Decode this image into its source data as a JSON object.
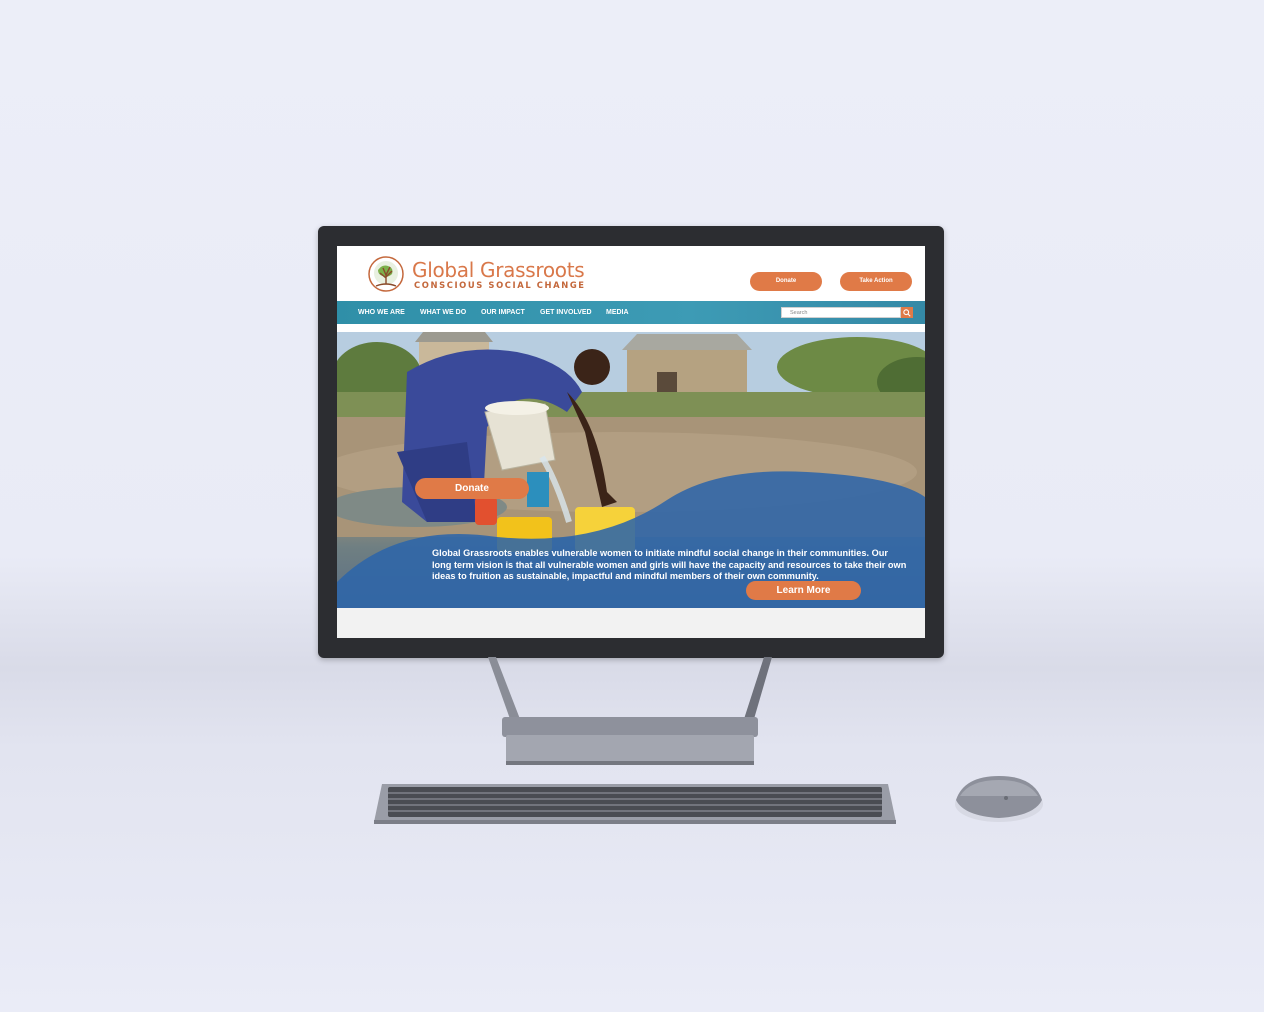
{
  "header": {
    "brand_title": "Global Grassroots",
    "brand_tagline": "CONSCIOUS SOCIAL CHANGE",
    "donate_label": "Donate",
    "take_action_label": "Take Action",
    "logo_icon": "tree-globe-logo-icon"
  },
  "nav": {
    "items": [
      {
        "label": "WHO WE ARE"
      },
      {
        "label": "WHAT WE DO"
      },
      {
        "label": "OUR IMPACT"
      },
      {
        "label": "GET INVOLVED"
      },
      {
        "label": "MEDIA"
      }
    ],
    "search_placeholder": "Search",
    "search_icon": "search-icon"
  },
  "hero": {
    "donate_label": "Donate",
    "body_text": "Global Grassroots enables vulnerable women to initiate mindful social change in their communities. Our long term  vision is that all vulnerable women and girls will have the capacity and resources to take their own ideas to fruition as sustainable, impactful and mindful members of their own community.",
    "learn_more_label": "Learn More"
  },
  "colors": {
    "accent": "#e07a47",
    "nav": "#3d9bb5",
    "brand_text": "#d9784a",
    "hero_overlay": "#2e65a8"
  }
}
